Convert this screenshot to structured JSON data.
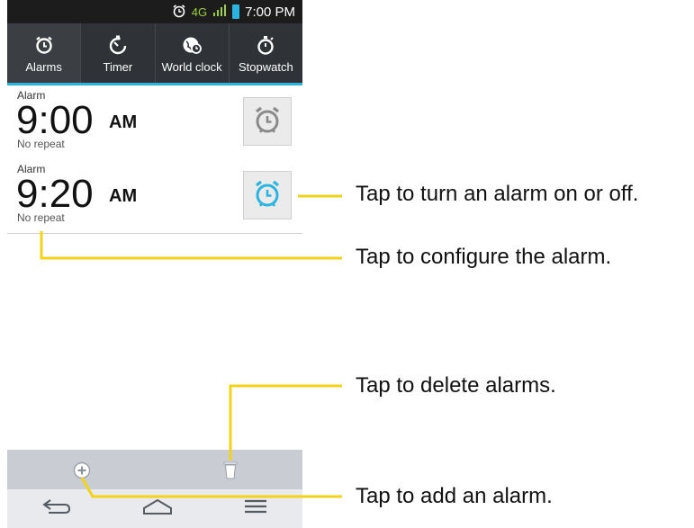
{
  "status_bar": {
    "time": "7:00 PM",
    "network": "4G",
    "icons": [
      "alarm-icon",
      "4g-lte-icon",
      "signal-icon",
      "battery-icon"
    ]
  },
  "tabs": [
    {
      "label": "Alarms",
      "icon": "alarm-clock-icon",
      "active": true
    },
    {
      "label": "Timer",
      "icon": "timer-icon",
      "active": false
    },
    {
      "label": "World clock",
      "icon": "world-clock-icon",
      "active": false
    },
    {
      "label": "Stopwatch",
      "icon": "stopwatch-icon",
      "active": false
    }
  ],
  "alarms": [
    {
      "label": "Alarm",
      "time": "9:00",
      "ampm": "AM",
      "repeat": "No repeat",
      "enabled": false
    },
    {
      "label": "Alarm",
      "time": "9:20",
      "ampm": "AM",
      "repeat": "No repeat",
      "enabled": true
    }
  ],
  "bottom_bar": {
    "add_icon": "add-icon",
    "delete_icon": "trash-icon"
  },
  "nav_bar": {
    "icons": [
      "back-icon",
      "home-icon",
      "menu-icon"
    ]
  },
  "callouts": {
    "toggle": "Tap to turn an alarm on or off.",
    "configure": "Tap to configure the alarm.",
    "delete": "Tap to delete alarms.",
    "add": "Tap to add an alarm."
  },
  "colors": {
    "accent": "#2bb4e0",
    "callout_line": "#f2d31b",
    "tab_bar": "#2f3236",
    "status_bar": "#1c1c1c"
  }
}
